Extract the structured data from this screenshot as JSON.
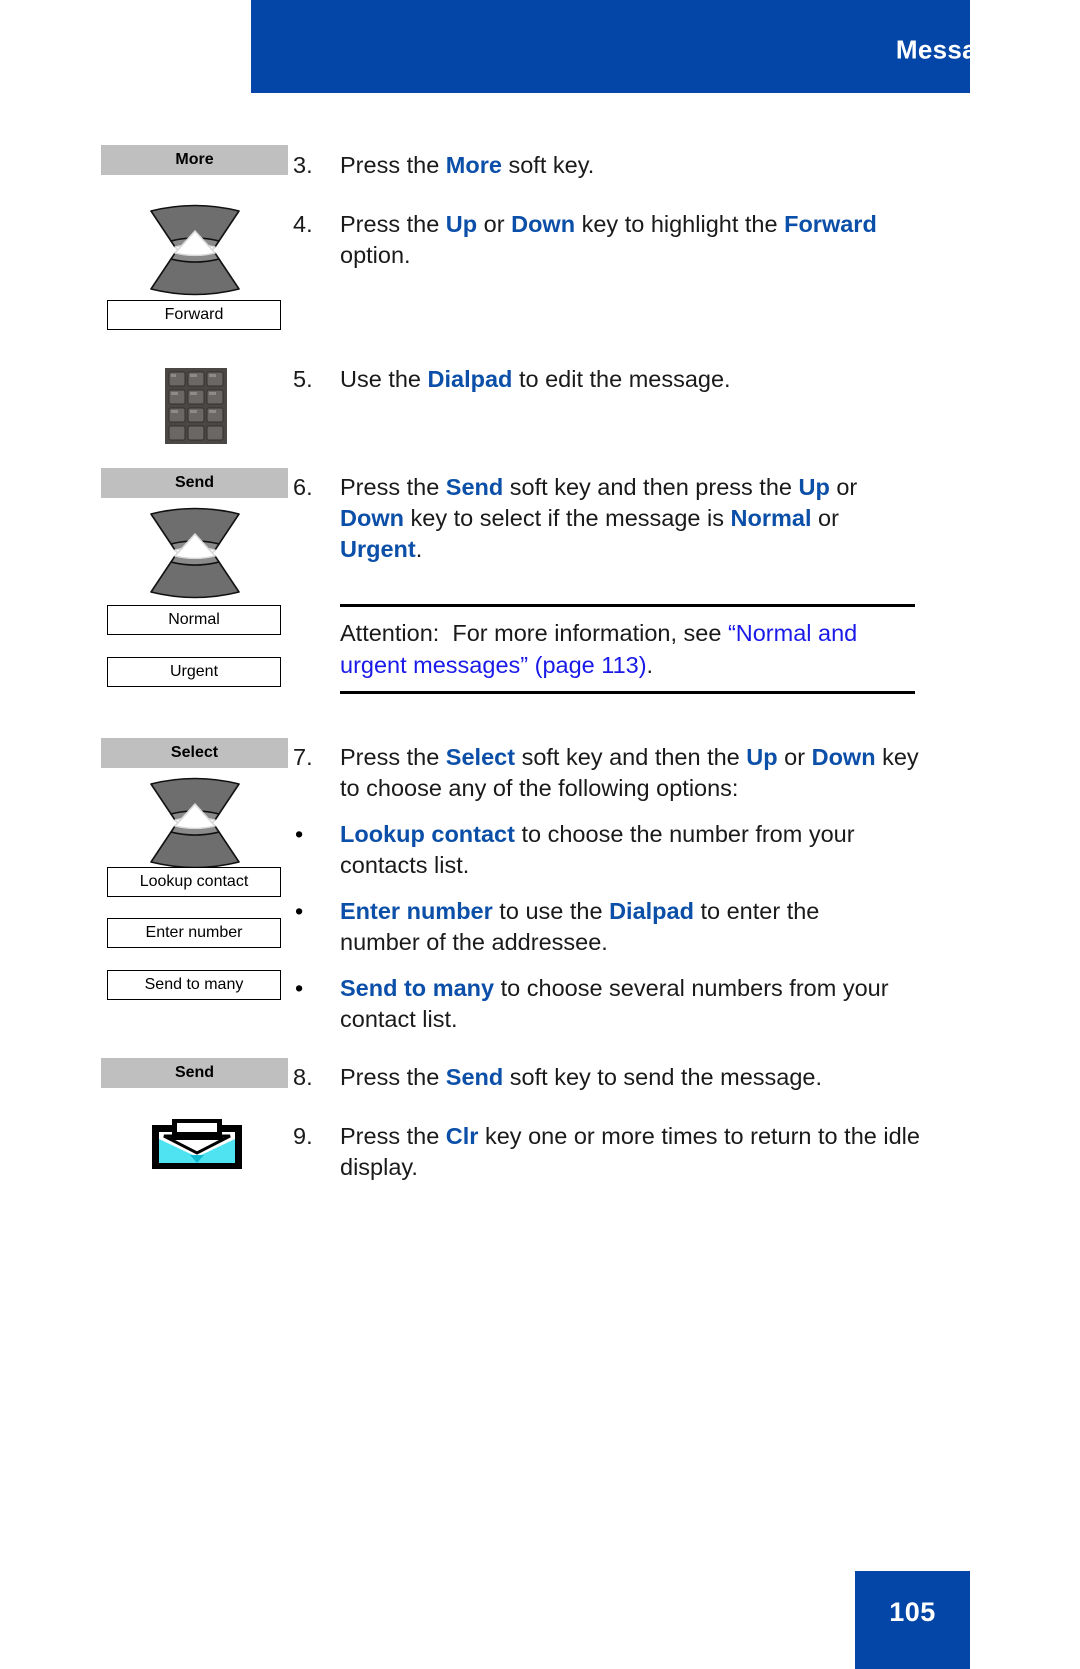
{
  "header": {
    "title": "Messaging"
  },
  "footer": {
    "page_number": "105"
  },
  "icons": {
    "navkey": "navigation-up-down-key-icon",
    "dialpad": "dialpad-icon",
    "clr": "clr-key-inbox-icon"
  },
  "colors": {
    "brand_blue": "#0445A8",
    "keyword_blue": "#0B4FA8",
    "link_blue": "#1A1AE8",
    "softkey_gray": "#BFBFBF"
  },
  "gutter": {
    "softkey_more": "More",
    "optbox_forward": "Forward",
    "softkey_send_1": "Send",
    "optbox_normal": "Normal",
    "optbox_urgent": "Urgent",
    "softkey_select": "Select",
    "optbox_lookup_contact": "Lookup contact",
    "optbox_enter_number": "Enter number",
    "optbox_send_to_many": "Send to many",
    "softkey_send_2": "Send"
  },
  "steps": [
    {
      "number": "3.",
      "parts": [
        {
          "t": "Press the ",
          "k": false
        },
        {
          "t": "More",
          "k": true
        },
        {
          "t": " soft key.",
          "k": false
        }
      ]
    },
    {
      "number": "4.",
      "parts": [
        {
          "t": "Press the ",
          "k": false
        },
        {
          "t": "Up",
          "k": true
        },
        {
          "t": " or ",
          "k": false
        },
        {
          "t": "Down",
          "k": true
        },
        {
          "t": " key to highlight the ",
          "k": false
        },
        {
          "t": "Forward",
          "k": true
        },
        {
          "t": " option.",
          "k": false
        }
      ]
    },
    {
      "number": "5.",
      "parts": [
        {
          "t": "Use the ",
          "k": false
        },
        {
          "t": "Dialpad",
          "k": true
        },
        {
          "t": " to edit the message.",
          "k": false
        }
      ]
    },
    {
      "number": "6.",
      "parts": [
        {
          "t": "Press the ",
          "k": false
        },
        {
          "t": "Send",
          "k": true
        },
        {
          "t": " soft key and then press the ",
          "k": false
        },
        {
          "t": "Up",
          "k": true
        },
        {
          "t": " or ",
          "k": false
        },
        {
          "t": "Down",
          "k": true
        },
        {
          "t": " key to select if the message is ",
          "k": false
        },
        {
          "t": "Normal",
          "k": true
        },
        {
          "t": " or ",
          "k": false
        },
        {
          "t": "Urgent",
          "k": true
        },
        {
          "t": ".",
          "k": false
        }
      ]
    },
    {
      "number": "7.",
      "parts": [
        {
          "t": "Press the ",
          "k": false
        },
        {
          "t": "Select",
          "k": true
        },
        {
          "t": " soft key and then the ",
          "k": false
        },
        {
          "t": "Up",
          "k": true
        },
        {
          "t": " or ",
          "k": false
        },
        {
          "t": "Down",
          "k": true
        },
        {
          "t": " key to choose any of the following options:",
          "k": false
        }
      ]
    },
    {
      "number": "8.",
      "parts": [
        {
          "t": "Press the ",
          "k": false
        },
        {
          "t": "Send",
          "k": true
        },
        {
          "t": " soft key to send the message.",
          "k": false
        }
      ]
    },
    {
      "number": "9.",
      "parts": [
        {
          "t": "Press the ",
          "k": false
        },
        {
          "t": "Clr",
          "k": true
        },
        {
          "t": " key one or more times to return to the idle display.",
          "k": false
        }
      ]
    }
  ],
  "bullets": [
    {
      "marker": "•",
      "parts": [
        {
          "t": "Lookup contact",
          "k": true
        },
        {
          "t": " to choose the number from your contacts list.",
          "k": false
        }
      ]
    },
    {
      "marker": "•",
      "parts": [
        {
          "t": "Enter number",
          "k": true
        },
        {
          "t": " to use the ",
          "k": false
        },
        {
          "t": "Dialpad",
          "k": true
        },
        {
          "t": " to enter the number of the addressee.",
          "k": false
        }
      ]
    },
    {
      "marker": "•",
      "parts": [
        {
          "t": "Send to many",
          "k": true
        },
        {
          "t": " to choose several numbers from your contact list.",
          "k": false
        }
      ]
    }
  ],
  "attention": {
    "label": "Attention:",
    "body_before": "For more information, see ",
    "link_text": "“Normal and urgent messages” (page 113)",
    "body_after": "."
  }
}
